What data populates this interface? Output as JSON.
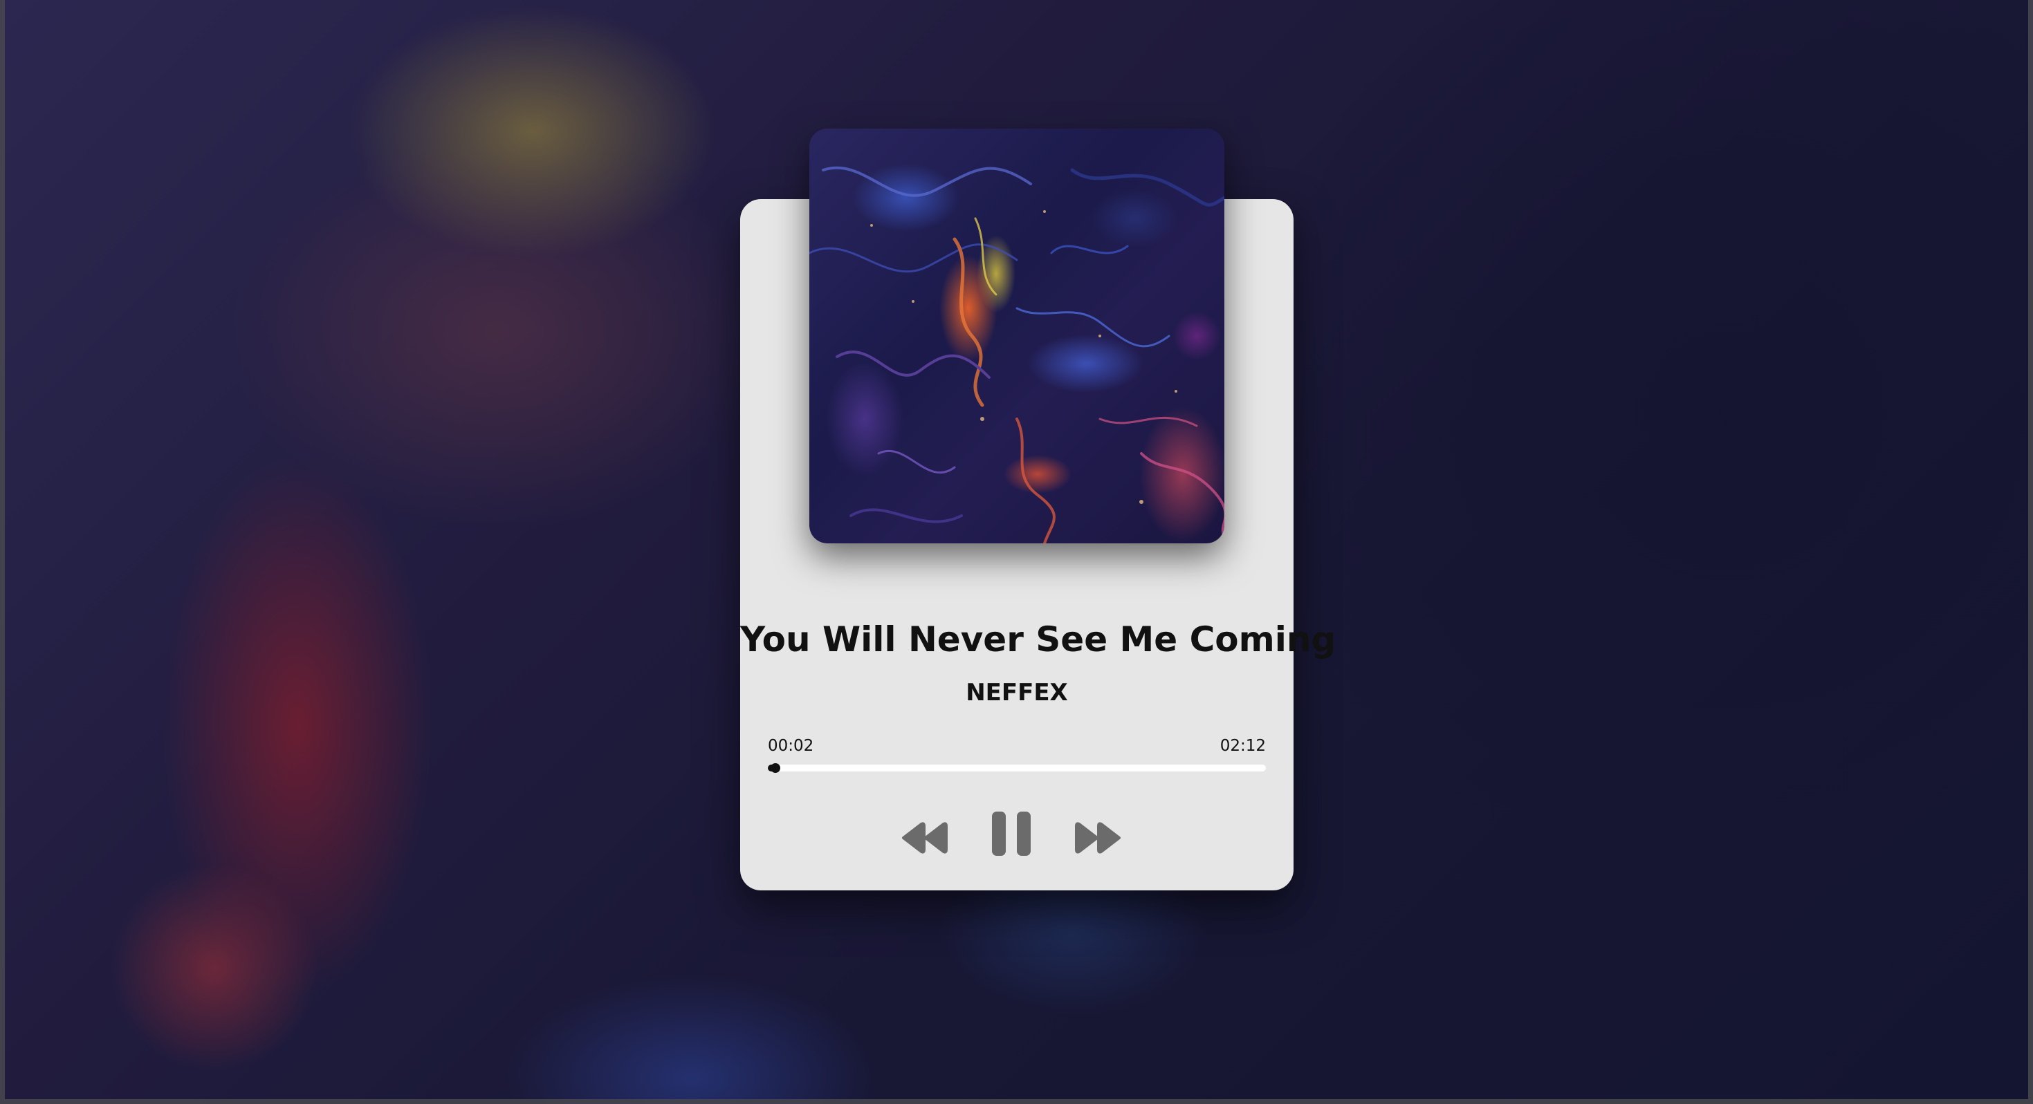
{
  "track": {
    "title": "You Will Never See Me Coming",
    "artist": "NEFFEX"
  },
  "playback": {
    "current_time": "00:02",
    "duration": "02:12",
    "progress_fraction": 0.015,
    "state": "playing"
  },
  "controls": {
    "prev_icon": "rewind-icon",
    "play_pause_icon": "pause-icon",
    "next_icon": "fast-forward-icon"
  },
  "colors": {
    "card_background": "#e6e6e6",
    "control_icon": "#6b6b6b",
    "text": "#111111",
    "progress_track": "#ffffff",
    "progress_fill": "#111111"
  }
}
